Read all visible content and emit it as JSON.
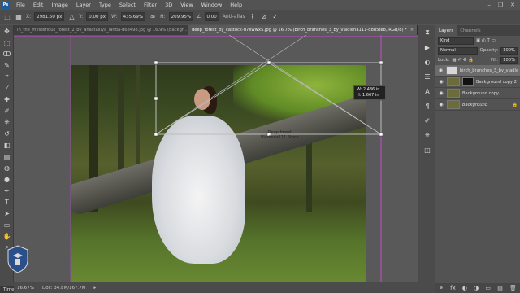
{
  "menubar": {
    "logo_text": "Ps",
    "items": [
      "File",
      "Edit",
      "Image",
      "Layer",
      "Type",
      "Select",
      "Filter",
      "3D",
      "View",
      "Window",
      "Help"
    ],
    "window_controls": [
      "–",
      "❐",
      "✕"
    ]
  },
  "options_bar": {
    "x_label": "X:",
    "x_value": "2981.50 px",
    "y_label": "Y:",
    "y_value": "0.00 px",
    "w_label": "W:",
    "w_value": "435.69%",
    "h_label": "H:",
    "h_value": "209.95%",
    "angle_label": "∠",
    "angle_value": "0.00",
    "interp_label": "Anti-alias",
    "cancel_icon": "cancel-icon",
    "commit_icon": "commit-icon"
  },
  "tabs": [
    {
      "label": "in_the_mysterious_forest_2_by_anastasiya_landa-d6e498.jpg @ 16.9% (Backgr...",
      "active": false
    },
    {
      "label": "deep_forest_by_castock-d7xwwx5.jpg @ 16.7% (birch_branches_3_by_vladlena111-d8u5te8, RGB/8) *",
      "active": true
    }
  ],
  "canvas": {
    "info_line1": "W: 2.486 in",
    "info_line2": "H: 1.667 in",
    "watermark_line1": "Deep forest",
    "watermark_line2": "Vladlena111 Stock"
  },
  "status": {
    "zoom": "16.67%",
    "doc": "Doc: 34.8M/167.7M",
    "arrow": "▸"
  },
  "timeline": {
    "label": "Timeline"
  },
  "layers_panel": {
    "tab_layers": "Layers",
    "tab_channels": "Channels",
    "kind_label": "Kind",
    "blend_mode": "Normal",
    "opacity_label": "Opacity:",
    "opacity_value": "100%",
    "lock_label": "Lock:",
    "fill_label": "Fill:",
    "fill_value": "100%",
    "layers": [
      {
        "name": "birch_branches_3_by_vladlena...",
        "selected": true,
        "italic": false,
        "has_mask": false
      },
      {
        "name": "Background copy 2",
        "selected": false,
        "italic": false,
        "has_mask": true
      },
      {
        "name": "Background copy",
        "selected": false,
        "italic": false,
        "has_mask": false
      },
      {
        "name": "Background",
        "selected": false,
        "italic": true,
        "has_mask": false
      }
    ],
    "bottom_icons": [
      "⚭",
      "fx",
      "◐",
      "◑",
      "▭",
      "▤",
      "🗑"
    ]
  }
}
